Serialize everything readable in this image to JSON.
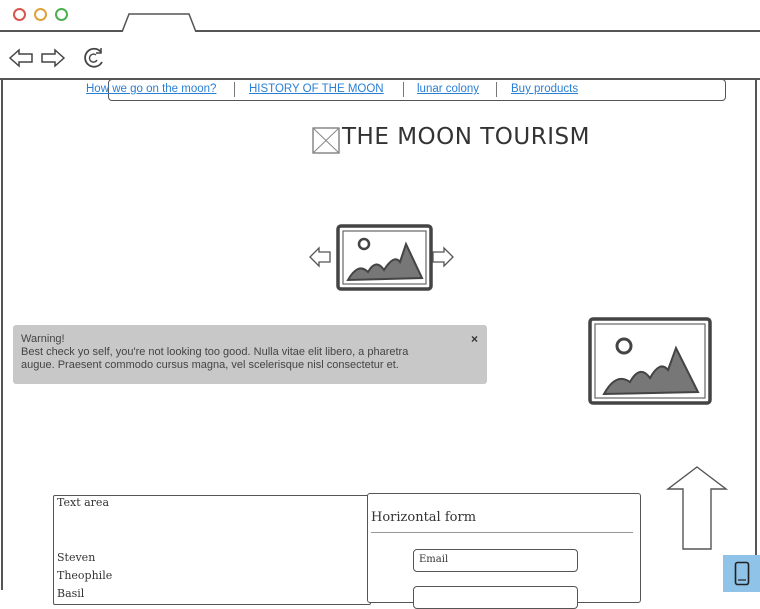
{
  "browser": {
    "window_controls": [
      "close",
      "minimize",
      "maximize"
    ],
    "colors": {
      "close": "#d9534f",
      "minimize": "#e0a13a",
      "maximize": "#4caf50"
    },
    "url": ""
  },
  "nav": {
    "links": [
      {
        "label": "How we go on the moon?"
      },
      {
        "label": "HISTORY OF THE MOON"
      },
      {
        "label": "lunar colony"
      },
      {
        "label": "Buy products"
      }
    ],
    "link_color": "#2a7fd4"
  },
  "site": {
    "title": "THE MOON TOURISM"
  },
  "alert": {
    "heading": "Warning!",
    "body": "Best check yo self, you're not looking too good. Nulla vitae elit libero, a pharetra augue. Praesent commodo cursus magna, vel scelerisque nisl consectetur et.",
    "close_label": "×",
    "background": "#c8c8c8"
  },
  "textarea": {
    "placeholder": "Text area",
    "lines": [
      "Steven",
      "Theophile",
      "Basil"
    ]
  },
  "form": {
    "title": "Horizontal form",
    "email_placeholder": "Email"
  },
  "icons": {
    "carousel_prev": "arrow-left-icon",
    "carousel_next": "arrow-right-icon",
    "back": "back-arrow-icon",
    "forward": "forward-arrow-icon",
    "reload": "reload-icon",
    "scroll_top": "arrow-up-icon",
    "mobile": "mobile-phone-icon",
    "accent": "#8fc3e8"
  }
}
